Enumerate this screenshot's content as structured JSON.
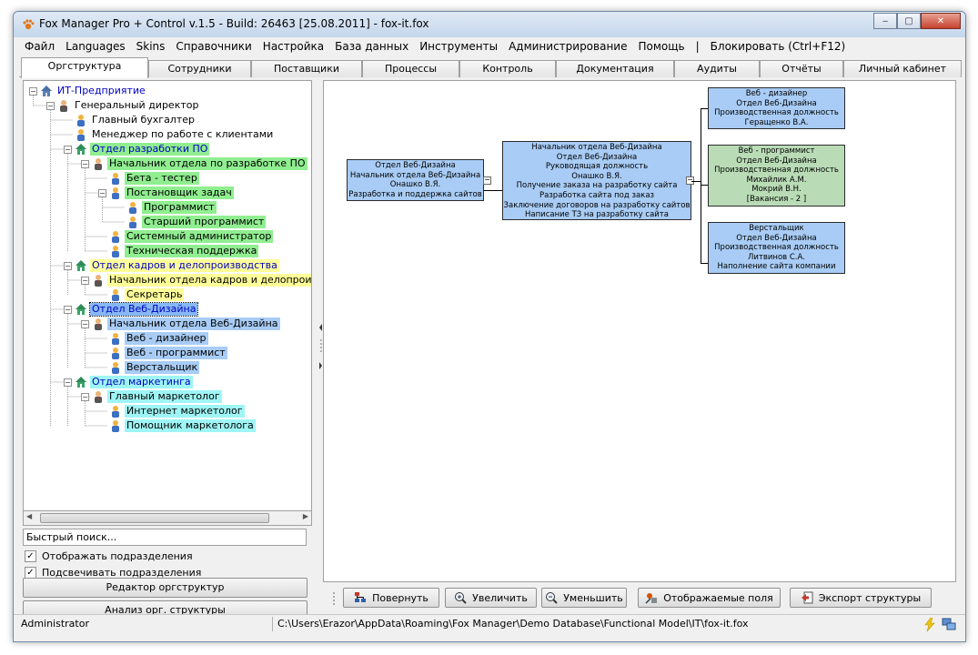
{
  "window": {
    "title": "Fox Manager Pro + Control v.1.5 - Build: 26463 [25.08.2011]  -  fox-it.fox",
    "minimize_label": "‒",
    "maximize_label": "▢",
    "close_label": "✕"
  },
  "menu": [
    "Файл",
    "Languages",
    "Skins",
    "Справочники",
    "Настройка",
    "База данных",
    "Инструменты",
    "Администрирование",
    "Помощь",
    "|",
    "Блокировать (Ctrl+F12)"
  ],
  "tabs": [
    "Оргструктура",
    "Сотрудники",
    "Поставщики",
    "Процессы",
    "Контроль",
    "Документация",
    "Аудиты",
    "Отчёты",
    "Личный кабинет"
  ],
  "tree": [
    {
      "label": "ИТ-Предприятие",
      "icon": "building-icon",
      "highlight": "none"
    },
    {
      "label": "Генеральный директор",
      "icon": "manager-icon",
      "highlight": "none"
    },
    {
      "label": "Главный бухгалтер",
      "icon": "person-icon",
      "highlight": "none"
    },
    {
      "label": "Менеджер по работе с клиентами",
      "icon": "person-icon",
      "highlight": "none"
    },
    {
      "label": "Отдел разработки ПО",
      "icon": "department-icon",
      "highlight": "#90ee90"
    },
    {
      "label": "Начальник отдела по разработке ПО",
      "icon": "manager-icon",
      "highlight": "#90ee90"
    },
    {
      "label": "Бета - тестер",
      "icon": "person-icon",
      "highlight": "#90ee90"
    },
    {
      "label": "Постановщик задач",
      "icon": "person-icon",
      "highlight": "#90ee90"
    },
    {
      "label": "Программист",
      "icon": "person-icon",
      "highlight": "#90ee90"
    },
    {
      "label": "Старший программист",
      "icon": "person-icon",
      "highlight": "#90ee90"
    },
    {
      "label": "Системный администратор",
      "icon": "person-icon",
      "highlight": "#90ee90"
    },
    {
      "label": "Техническая поддержка",
      "icon": "person-icon",
      "highlight": "#90ee90"
    },
    {
      "label": "Отдел кадров и делопроизводства",
      "icon": "department-icon",
      "highlight": "#ffff99"
    },
    {
      "label": "Начальник отдела кадров и делопроизводства",
      "icon": "manager-icon",
      "highlight": "#ffff99"
    },
    {
      "label": "Секретарь",
      "icon": "person-icon",
      "highlight": "#ffff99"
    },
    {
      "label": "Отдел Веб-Дизайна",
      "icon": "department-icon",
      "highlight": "#87b8f5"
    },
    {
      "label": "Начальник отдела Веб-Дизайна",
      "icon": "manager-icon",
      "highlight": "#a8ccf5"
    },
    {
      "label": "Веб - дизайнер",
      "icon": "person-icon",
      "highlight": "#a8ccf5"
    },
    {
      "label": "Веб - программист",
      "icon": "person-icon",
      "highlight": "#a8ccf5"
    },
    {
      "label": "Верстальщик",
      "icon": "person-icon",
      "highlight": "#a8ccf5"
    },
    {
      "label": "Отдел маркетинга",
      "icon": "department-icon",
      "highlight": "#9ff5f5"
    },
    {
      "label": "Главный маркетолог",
      "icon": "manager-icon",
      "highlight": "#9ff5f5"
    },
    {
      "label": "Интернет маркетолог",
      "icon": "person-icon",
      "highlight": "#9ff5f5"
    },
    {
      "label": "Помощник маркетолога",
      "icon": "person-icon",
      "highlight": "#9ff5f5"
    }
  ],
  "left": {
    "search_placeholder": "Быстрый поиск...",
    "show_units": "Отображать подразделения",
    "highlight_units": "Подсвечивать подразделения",
    "show_units_checked": true,
    "highlight_units_checked": true,
    "editor_button": "Редактор оргструктур",
    "analysis_button": "Анализ орг. структуры"
  },
  "chart": {
    "dept_box": [
      "Отдел Веб-Дизайна",
      "Начальник отдела Веб-Дизайна",
      "Онашко В.Я.",
      "Разработка и поддержка сайтов"
    ],
    "head_box": [
      "Начальник отдела Веб-Дизайна",
      "Отдел Веб-Дизайна",
      "Руководящая должность",
      "Онашко В.Я.",
      "Получение заказа на разработку сайта",
      "Разработка сайта под заказ",
      "Заключение договоров на разработку сайтов",
      "Написание ТЗ на разработку сайта"
    ],
    "designer_box": [
      "Веб - дизайнер",
      "Отдел Веб-Дизайна",
      "Производственная должность",
      "Геращенко В.А."
    ],
    "programmer_box": [
      "Веб - программист",
      "Отдел Веб-Дизайна",
      "Производственная должность",
      "Михайлик А.М.",
      "Мокрий В.Н.",
      "[Вакансия - 2 ]"
    ],
    "coder_box": [
      "Верстальщик",
      "Отдел Веб-Дизайна",
      "Производственная должность",
      "Литвинов С.А.",
      "Наполнение сайта компании"
    ],
    "collapse_symbol": "−"
  },
  "toolbar": {
    "rotate": "Повернуть",
    "zoom_in": "Увеличить",
    "zoom_out": "Уменьшить",
    "fields": "Отображаемые поля",
    "export": "Экспорт структуры"
  },
  "status": {
    "user": "Administrator",
    "path": "C:\\Users\\Erazor\\AppData\\Roaming\\Fox Manager\\Demo Database\\Functional Model\\IT\\fox-it.fox"
  }
}
